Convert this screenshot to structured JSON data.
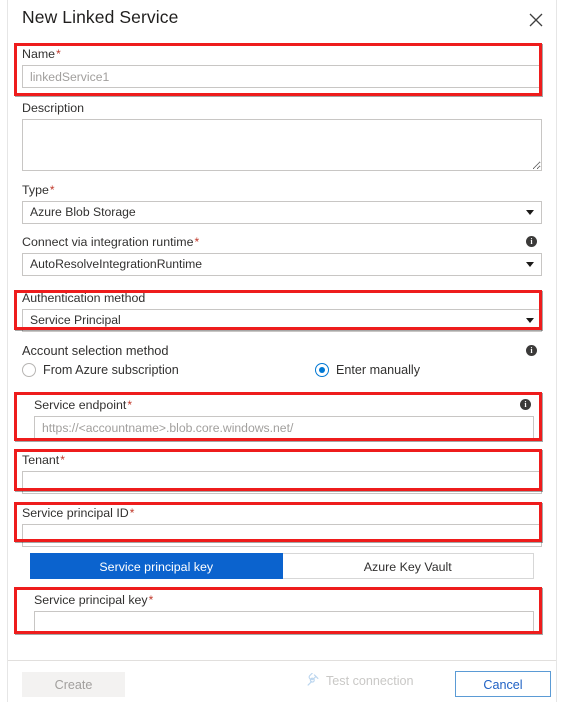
{
  "dialog": {
    "title": "New Linked Service",
    "close_icon": "close-icon"
  },
  "fields": {
    "name": {
      "label": "Name",
      "required": "*",
      "value": "linkedService1"
    },
    "description": {
      "label": "Description",
      "value": ""
    },
    "type": {
      "label": "Type",
      "required": "*",
      "value": "Azure Blob Storage"
    },
    "integration_runtime": {
      "label": "Connect via integration runtime",
      "required": "*",
      "value": "AutoResolveIntegrationRuntime",
      "info_icon": "info-icon"
    },
    "auth_method": {
      "label": "Authentication method",
      "value": "Service Principal"
    },
    "account_selection": {
      "label": "Account selection method",
      "info_icon": "info-icon",
      "options": [
        {
          "label": "From Azure subscription",
          "selected": false
        },
        {
          "label": "Enter manually",
          "selected": true
        }
      ]
    },
    "service_endpoint": {
      "label": "Service endpoint",
      "required": "*",
      "placeholder": "https://<accountname>.blob.core.windows.net/",
      "value": "",
      "info_icon": "info-icon"
    },
    "tenant": {
      "label": "Tenant",
      "required": "*",
      "value": ""
    },
    "service_principal_id": {
      "label": "Service principal ID",
      "required": "*",
      "value": ""
    },
    "service_principal_key": {
      "label": "Service principal key",
      "required": "*",
      "value": ""
    }
  },
  "credential_tabs": {
    "active": "Service principal key",
    "items": [
      {
        "label": "Service principal key",
        "active": true
      },
      {
        "label": "Azure Key Vault",
        "active": false
      }
    ]
  },
  "footer": {
    "create_label": "Create",
    "test_connection_label": "Test connection",
    "test_connection_icon": "plug-connector-icon",
    "cancel_label": "Cancel"
  },
  "colors": {
    "highlight": "#ee1c1c",
    "accent": "#0b63ce",
    "radio_accent": "#0078d4",
    "cancel_border": "#5b9bd5",
    "required_asterisk": "#c0392b"
  }
}
